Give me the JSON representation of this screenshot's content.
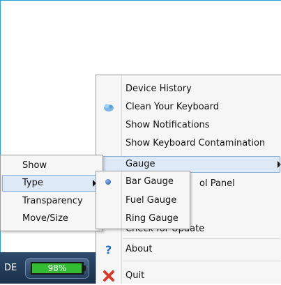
{
  "taskbar": {
    "language": "DE",
    "battery_percent_label": "98%",
    "battery_level": 0.98,
    "battery_color": "#33bb33"
  },
  "main_menu": {
    "items": [
      {
        "label": "Device History",
        "icon": ""
      },
      {
        "label": "Clean Your Keyboard",
        "icon": "keyboard-clean-icon"
      },
      {
        "label": "Show Notifications",
        "icon": ""
      },
      {
        "label": "Show Keyboard Contamination",
        "icon": ""
      },
      {
        "label": "Gauge",
        "icon": "",
        "submenu": true,
        "highlighted": true
      },
      {
        "label": "Control Panel",
        "icon": "",
        "visible_text": "ol Panel"
      },
      {
        "label": "Check for Update",
        "icon": "",
        "visible_text": "Check for Update"
      },
      {
        "label": "About",
        "icon": "help-icon"
      },
      {
        "label": "Quit",
        "icon": "close-icon"
      }
    ]
  },
  "gauge_menu": {
    "items": [
      {
        "label": "Show"
      },
      {
        "label": "Type",
        "submenu": true,
        "highlighted": true
      },
      {
        "label": "Transparency"
      },
      {
        "label": "Move/Size"
      }
    ]
  },
  "type_menu": {
    "items": [
      {
        "label": "Bar Gauge",
        "selected": true
      },
      {
        "label": "Fuel Gauge"
      },
      {
        "label": "Ring Gauge"
      }
    ]
  },
  "colors": {
    "highlight": "#dde9f6",
    "highlight_border": "#8cb4de",
    "radio": "#1f4fa8",
    "help_icon": "#2a6fc4",
    "quit_icon": "#d43a2a"
  }
}
